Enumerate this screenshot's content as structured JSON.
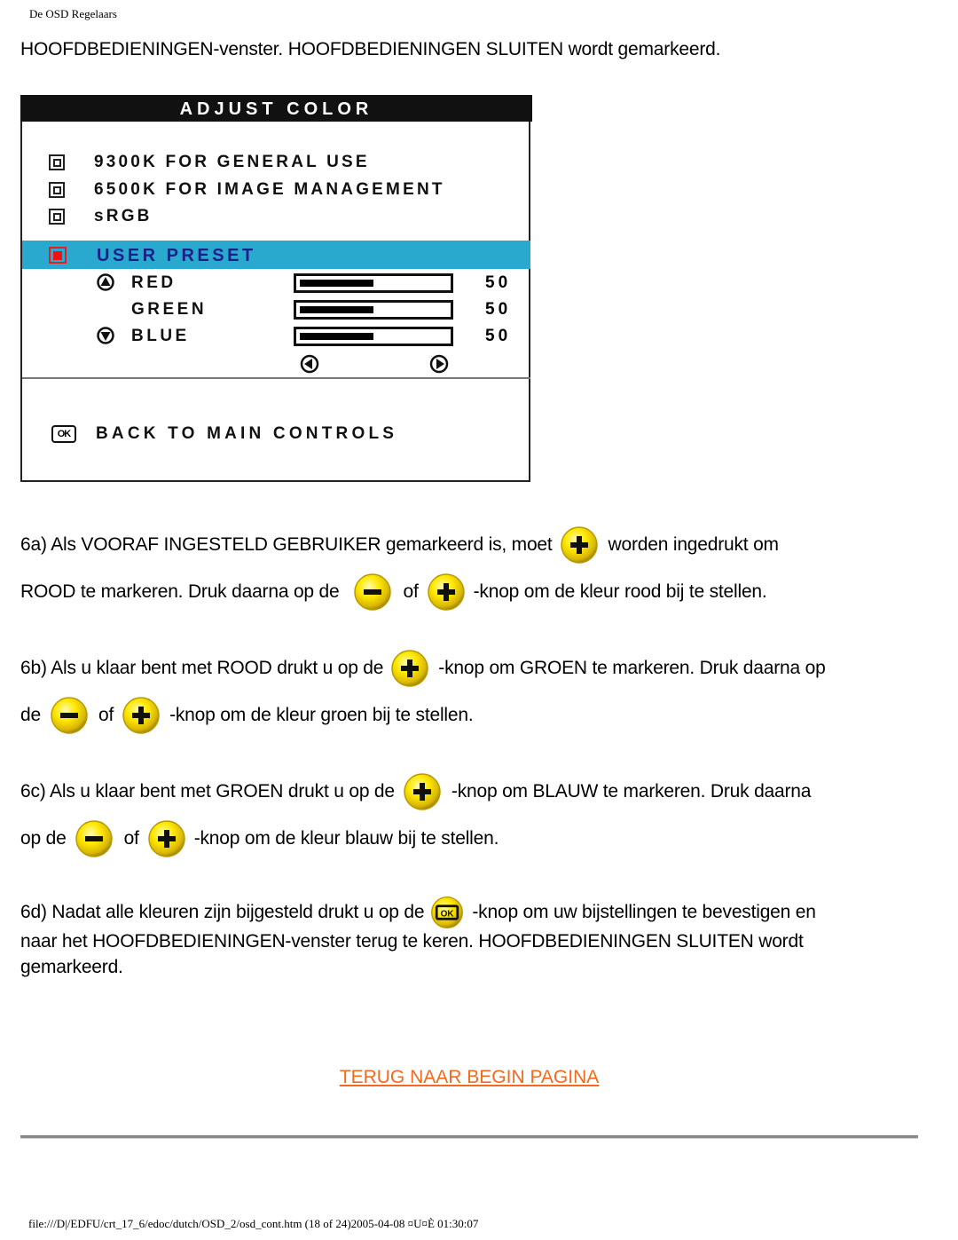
{
  "page_header": "De OSD Regelaars",
  "intro_text": "HOOFDBEDIENINGEN-venster. HOOFDBEDIENINGEN SLUITEN wordt gemarkeerd.",
  "osd": {
    "title": "ADJUST COLOR",
    "presets": [
      {
        "label": "9300K FOR GENERAL USE"
      },
      {
        "label": "6500K FOR IMAGE MANAGEMENT"
      },
      {
        "label": "sRGB"
      }
    ],
    "selected_preset": "USER PRESET",
    "colors": [
      {
        "name": "RED",
        "value": "50",
        "level": 0.5,
        "arrow": "up"
      },
      {
        "name": "GREEN",
        "value": "50",
        "level": 0.5,
        "arrow": ""
      },
      {
        "name": "BLUE",
        "value": "50",
        "level": 0.5,
        "arrow": "down"
      }
    ],
    "ok_label": "OK",
    "back_label": "BACK TO MAIN CONTROLS",
    "highlight_color": "#2aa9ce",
    "selected_text_color": "#1b1f8a"
  },
  "steps": {
    "s6a_l1_a": "6a) Als VOORAF INGESTELD GEBRUIKER gemarkeerd is, moet",
    "s6a_l1_b": "worden ingedrukt om",
    "s6a_l2_a": "ROOD te markeren. Druk daarna op de",
    "s6a_l2_of": "of",
    "s6a_l2_b": "-knop om de kleur rood bij te stellen.",
    "s6b_l1_a": "6b) Als u klaar bent met ROOD drukt u op de",
    "s6b_l1_b": "-knop om GROEN te markeren. Druk daarna op",
    "s6b_l2_a": "de",
    "s6b_l2_of": "of",
    "s6b_l2_b": "-knop om de kleur groen bij te stellen.",
    "s6c_l1_a": "6c) Als u klaar bent met GROEN drukt u op de",
    "s6c_l1_b": "-knop om BLAUW te markeren. Druk daarna",
    "s6c_l2_a": "op de",
    "s6c_l2_of": "of",
    "s6c_l2_b": "-knop om de kleur blauw bij te stellen.",
    "s6d_l1_a": "6d) Nadat alle kleuren zijn bijgesteld drukt u op de",
    "s6d_l1_b": "-knop om uw bijstellingen te bevestigen en",
    "s6d_l2": "naar het HOOFDBEDIENINGEN-venster terug te keren. HOOFDBEDIENINGEN SLUITEN wordt",
    "s6d_l3": "gemarkeerd."
  },
  "back_link": "TERUG NAAR BEGIN PAGINA",
  "link_color": "#f26a1b",
  "footer": "file:///D|/EDFU/crt_17_6/edoc/dutch/OSD_2/osd_cont.htm (18 of 24)2005-04-08 ¤U¤È 01:30:07"
}
